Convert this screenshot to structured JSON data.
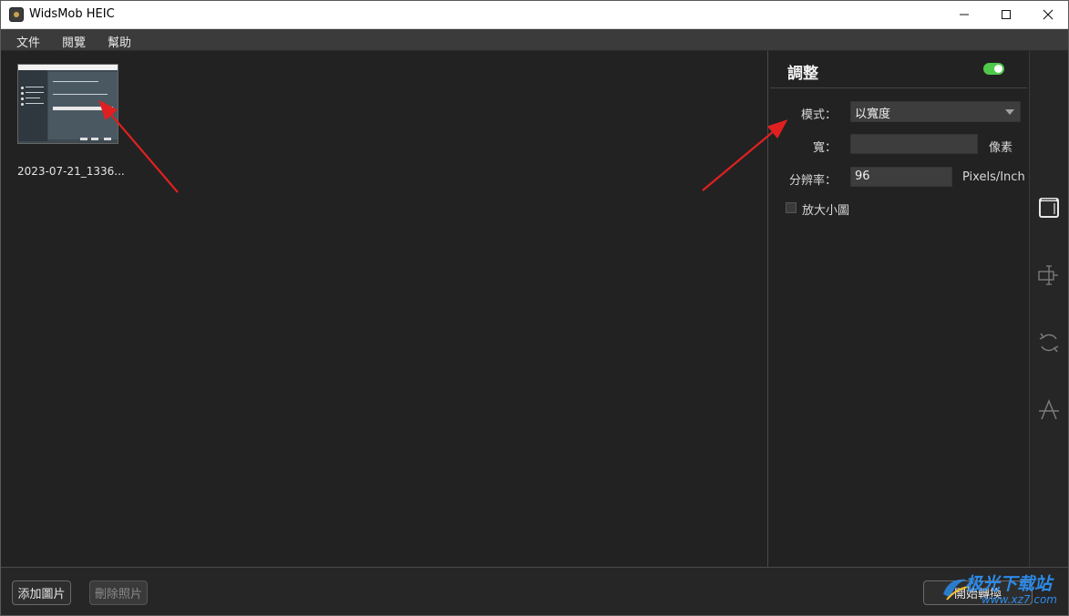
{
  "window": {
    "title": "WidsMob HEIC",
    "minimize_icon": "minimize-icon",
    "maximize_icon": "maximize-icon",
    "close_icon": "close-icon"
  },
  "menu": {
    "items": [
      {
        "label": "文件"
      },
      {
        "label": "閱覽"
      },
      {
        "label": "幫助"
      }
    ]
  },
  "files": [
    {
      "name": "2023-07-21_1336..."
    }
  ],
  "panel": {
    "title": "調整",
    "toggle_on": true,
    "mode_label": "模式：",
    "mode_value": "以寬度",
    "width_label": "寬：",
    "width_value": "",
    "width_unit": "像素",
    "resolution_label": "分辨率：",
    "resolution_value": "96",
    "resolution_unit": "Pixels/Inch",
    "enlarge_label": "放大小圖",
    "enlarge_checked": false
  },
  "side_tools": [
    {
      "icon": "resize-icon",
      "active": true
    },
    {
      "icon": "crop-icon",
      "active": false
    },
    {
      "icon": "rotate-icon",
      "active": false
    },
    {
      "icon": "watermark-text-icon",
      "active": false
    }
  ],
  "bottom": {
    "add_label": "添加圖片",
    "remove_label": "刪除照片",
    "start_label": "開始轉換"
  },
  "watermark": {
    "line1": "极光下载站",
    "line2": "www.xz7.com"
  },
  "colors": {
    "background": "#222222",
    "toggle_on": "#4fc94a",
    "annotation_arrow": "#e02020",
    "watermark": "#2c8ae8"
  }
}
